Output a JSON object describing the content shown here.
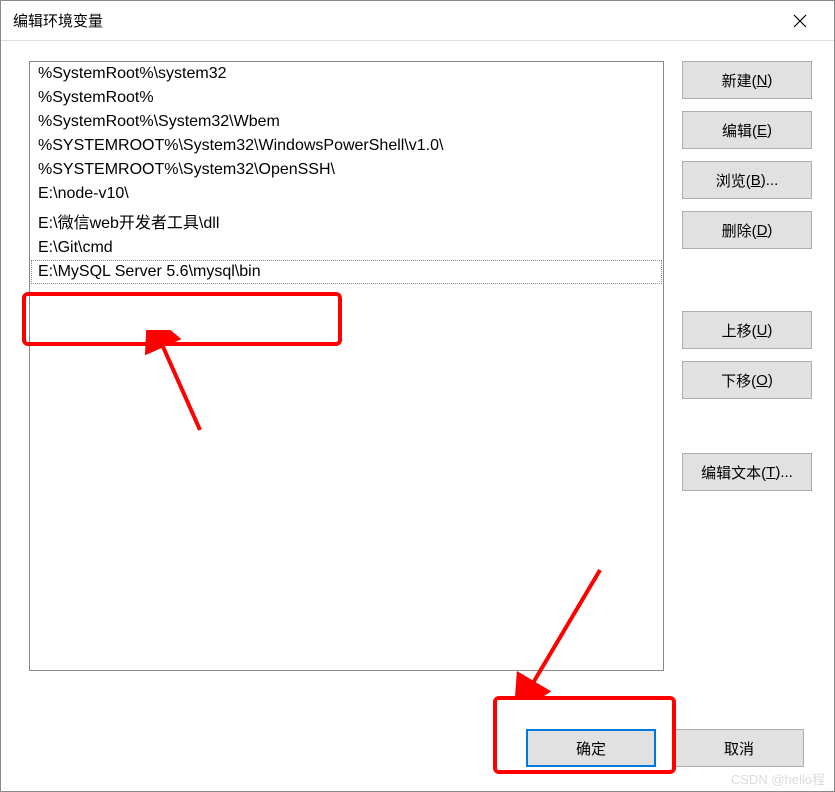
{
  "window": {
    "title": "编辑环境变量"
  },
  "list": {
    "items": [
      "%SystemRoot%\\system32",
      "%SystemRoot%",
      "%SystemRoot%\\System32\\Wbem",
      "%SYSTEMROOT%\\System32\\WindowsPowerShell\\v1.0\\",
      "%SYSTEMROOT%\\System32\\OpenSSH\\",
      "E:\\node-v10\\",
      "E:\\微信web开发者工具\\dll",
      "E:\\Git\\cmd",
      "E:\\MySQL Server 5.6\\mysql\\bin"
    ],
    "selected_index": 8
  },
  "buttons": {
    "new": {
      "label": "新建(",
      "accel": "N",
      "suffix": ")"
    },
    "edit": {
      "label": "编辑(",
      "accel": "E",
      "suffix": ")"
    },
    "browse": {
      "label": "浏览(",
      "accel": "B",
      "suffix": ")..."
    },
    "delete": {
      "label": "删除(",
      "accel": "D",
      "suffix": ")"
    },
    "moveup": {
      "label": "上移(",
      "accel": "U",
      "suffix": ")"
    },
    "movedown": {
      "label": "下移(",
      "accel": "O",
      "suffix": ")"
    },
    "edittext": {
      "label": "编辑文本(",
      "accel": "T",
      "suffix": ")..."
    }
  },
  "footer": {
    "ok": "确定",
    "cancel": "取消"
  },
  "watermark": "CSDN @hello程"
}
